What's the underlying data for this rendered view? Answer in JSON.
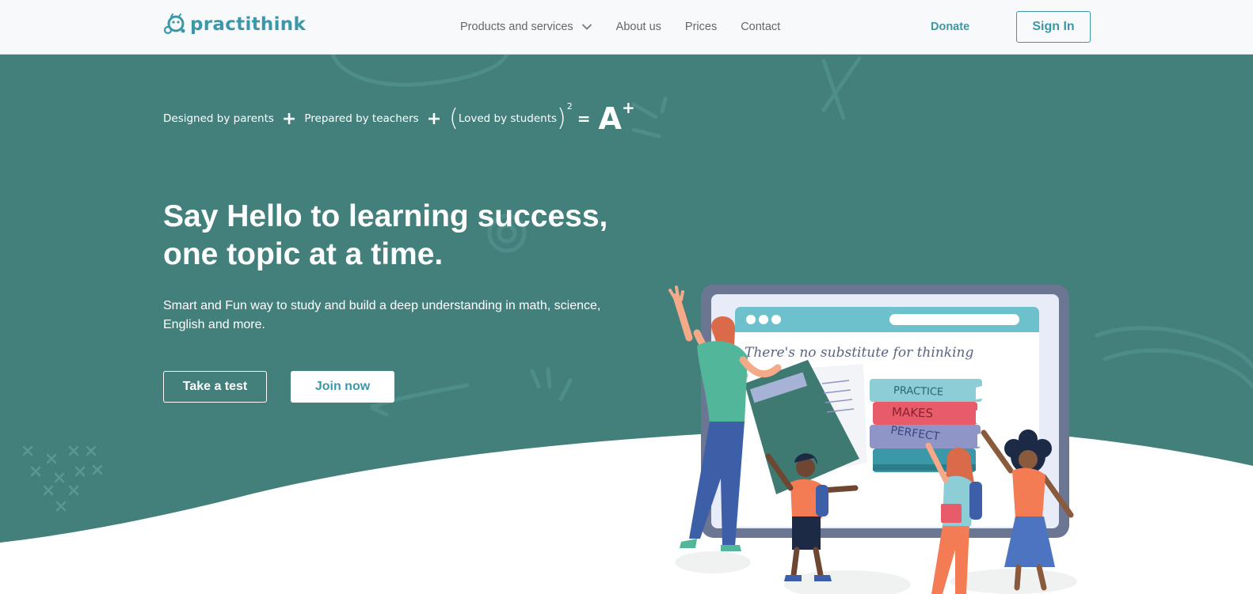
{
  "brand": {
    "name": "practithink",
    "primary_color": "#3b98a9",
    "hero_color": "#43807c"
  },
  "nav": {
    "items": [
      {
        "label": "Products and services",
        "has_dropdown": true
      },
      {
        "label": "About us"
      },
      {
        "label": "Prices"
      },
      {
        "label": "Contact"
      }
    ],
    "donate_label": "Donate",
    "signin_label": "Sign In"
  },
  "hero": {
    "formula": {
      "part1": "Designed by parents",
      "part2": "Prepared by teachers",
      "part3": "Loved by students",
      "exponent": "2",
      "result": "A",
      "result_sup": "+"
    },
    "headline_line1": "Say Hello to learning success,",
    "headline_line2": "one topic at a time.",
    "subtext": "Smart and Fun way to study and build a deep understanding in math, science, English and more.",
    "buttons": {
      "test_label": "Take a test",
      "join_label": "Join now"
    }
  },
  "illustration": {
    "screen_text": "There's no substitute for thinking",
    "book_labels": [
      "PRACTICE",
      "MAKES",
      "PERFECT"
    ]
  }
}
